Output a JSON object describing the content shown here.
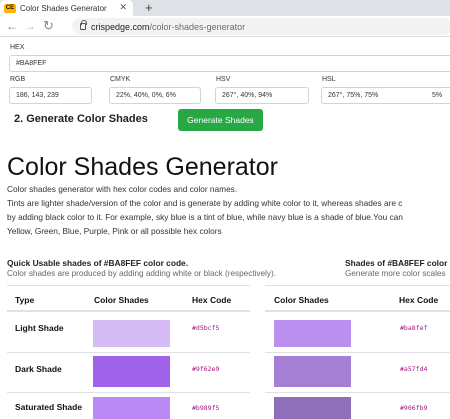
{
  "browser": {
    "tab_title": "Color Shades Generator",
    "favicon_text": "CE",
    "url_host": "crispedge.com",
    "url_path": "/color-shades-generator"
  },
  "form": {
    "hex_label": "HEX",
    "hex_value": "#BA8FEF",
    "rgb_label": "RGB",
    "rgb_value": "186, 143, 239",
    "cmyk_label": "CMYK",
    "cmyk_value": "22%, 40%, 0%, 6%",
    "hsv_label": "HSV",
    "hsv_value": "267°, 40%, 94%",
    "hsl_label": "HSL",
    "hsl_value": "267°, 75%, 75%",
    "hsl_extra": "5%"
  },
  "generate": {
    "heading": "2. Generate Color Shades",
    "button": "Generate Shades"
  },
  "article": {
    "title": "Color Shades Generator",
    "intro": "Color shades generator with hex color codes and color names.",
    "line1": "Tints are lighter shade/version of the color and is generate by adding white color to it, whereas shades are c",
    "line2": "by adding black color to it. For example, sky blue is a tint of blue, while navy blue is a shade of blue.You can",
    "line3": "Yellow, Green, Blue, Purple, Pink or all possible hex colors"
  },
  "left_section": {
    "heading": "Quick Usable shades of #BA8FEF color code.",
    "subtext": "Color shades are produced by adding adding white or black (respectively)."
  },
  "right_section": {
    "heading": "Shades of #BA8FEF color",
    "subtext": "Generate more color scales"
  },
  "left_table": {
    "headers": [
      "Type",
      "Color Shades",
      "Hex Code"
    ],
    "rows": [
      {
        "type": "Light Shade",
        "hex": "#d5bcf5",
        "color": "#d5bcf5"
      },
      {
        "type": "Dark Shade",
        "hex": "#9f62e9",
        "color": "#9f62e9"
      },
      {
        "type": "Saturated Shade",
        "hex": "#b989f5",
        "color": "#b989f5"
      }
    ]
  },
  "right_table": {
    "headers": [
      "Color Shades",
      "Hex Code"
    ],
    "rows": [
      {
        "hex": "#ba8fef",
        "color": "#ba8fef"
      },
      {
        "hex": "#a57fd4",
        "color": "#a57fd4"
      },
      {
        "hex": "#906fb9",
        "color": "#906fb9"
      }
    ]
  },
  "colors": {
    "accent_green": "#28a745",
    "hex_text": "#a3157e"
  }
}
